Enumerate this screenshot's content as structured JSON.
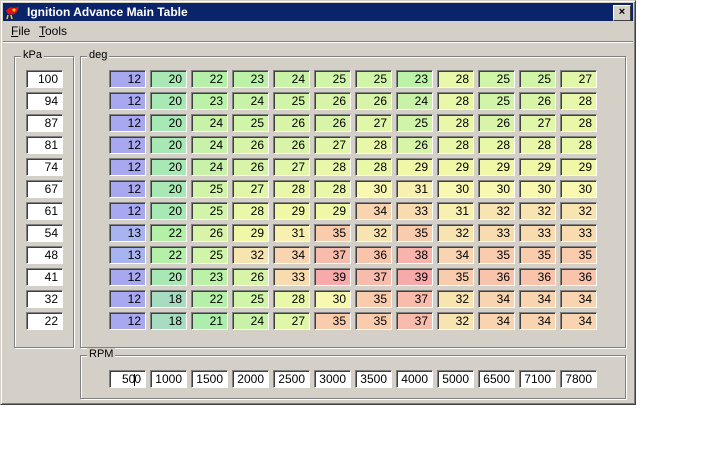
{
  "window": {
    "title": "Ignition Advance Main Table",
    "close_label": "×"
  },
  "menu": [
    {
      "label": "File",
      "accel": "F",
      "rest": "ile"
    },
    {
      "label": "Tools",
      "accel": "T",
      "rest": "ools"
    }
  ],
  "groups": {
    "kpa": "kPa",
    "deg": "deg",
    "rpm": "RPM"
  },
  "kpa": [
    "100",
    "94",
    "87",
    "81",
    "74",
    "67",
    "61",
    "54",
    "48",
    "41",
    "32",
    "22"
  ],
  "rpm": [
    "500",
    "1000",
    "1500",
    "2000",
    "2500",
    "3000",
    "3500",
    "4000",
    "5000",
    "6500",
    "7100",
    "7800"
  ],
  "table": [
    [
      12,
      20,
      22,
      23,
      24,
      25,
      25,
      23,
      28,
      25,
      25,
      27
    ],
    [
      12,
      20,
      23,
      24,
      25,
      26,
      26,
      24,
      28,
      25,
      26,
      28
    ],
    [
      12,
      20,
      24,
      25,
      26,
      26,
      27,
      25,
      28,
      26,
      27,
      28
    ],
    [
      12,
      20,
      24,
      26,
      26,
      27,
      28,
      26,
      28,
      28,
      28,
      28
    ],
    [
      12,
      20,
      24,
      26,
      27,
      28,
      28,
      29,
      29,
      29,
      29,
      29
    ],
    [
      12,
      20,
      25,
      27,
      28,
      28,
      30,
      31,
      30,
      30,
      30,
      30
    ],
    [
      12,
      20,
      25,
      28,
      29,
      29,
      34,
      33,
      31,
      32,
      32,
      32
    ],
    [
      13,
      22,
      26,
      29,
      31,
      35,
      32,
      35,
      32,
      33,
      33,
      33
    ],
    [
      13,
      22,
      25,
      32,
      34,
      37,
      36,
      38,
      34,
      35,
      35,
      35
    ],
    [
      12,
      20,
      23,
      26,
      33,
      39,
      37,
      39,
      35,
      36,
      36,
      36
    ],
    [
      12,
      18,
      22,
      25,
      28,
      30,
      35,
      37,
      32,
      34,
      34,
      34
    ],
    [
      12,
      18,
      21,
      24,
      27,
      35,
      35,
      37,
      32,
      34,
      34,
      34
    ]
  ],
  "value_colors": {
    "12": "#a8a8f0",
    "13": "#a8b4f0",
    "18": "#a8dcc0",
    "20": "#a8e8b4",
    "21": "#aeeeac",
    "22": "#b4f0a8",
    "23": "#bcf2a8",
    "24": "#c8f2a8",
    "25": "#d0f4a8",
    "26": "#d8f4a8",
    "27": "#e0f6a8",
    "28": "#e8f8a8",
    "29": "#f0f8a8",
    "30": "#f8f8b0",
    "31": "#f8f0b0",
    "32": "#f8e4b0",
    "33": "#f8dcb0",
    "34": "#f8d4b0",
    "35": "#f8ccac",
    "36": "#f8c4ac",
    "37": "#f8bcac",
    "38": "#f8b4ac",
    "39": "#f8aaaa"
  },
  "title_bar_color": "#0a246a"
}
